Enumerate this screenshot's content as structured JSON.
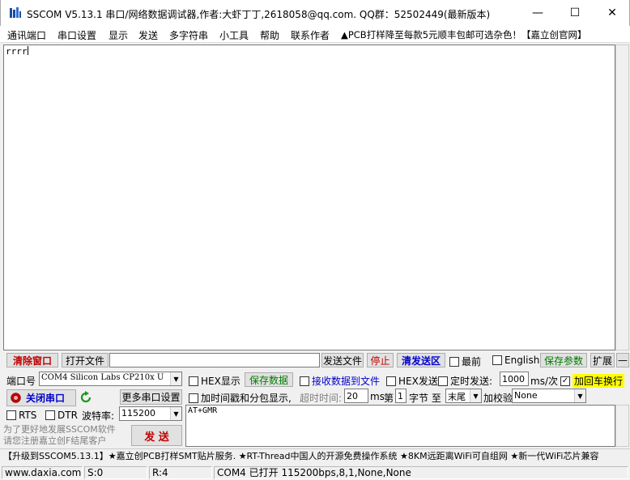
{
  "window": {
    "title": "SSCOM V5.13.1 串口/网络数据调试器,作者:大虾丁丁,2618058@qq.com. QQ群：52502449(最新版本)",
    "minimize": "—",
    "maximize": "☐",
    "close": "✕"
  },
  "menu": [
    "通讯端口",
    "串口设置",
    "显示",
    "发送",
    "多字符串",
    "小工具",
    "帮助",
    "联系作者",
    "▲PCB打样降至每款5元顺丰包邮可选杂色！【嘉立创官网】"
  ],
  "receive": {
    "text": "rrrr"
  },
  "toolbar": {
    "clear_window": "清除窗口",
    "open_file": "打开文件",
    "file_path": "",
    "send_file": "发送文件",
    "stop": "停止",
    "clear_send": "清发送区",
    "topmost": "最前",
    "english": "English",
    "save_params": "保存参数",
    "expand": "扩展",
    "collapse": "—"
  },
  "port": {
    "label": "端口号",
    "selected": "COM4 Silicon Labs CP210x U",
    "close_port": "关闭串口",
    "more_settings": "更多串口设置",
    "rts": "RTS",
    "dtr": "DTR",
    "baud_label": "波特率:",
    "baud": "115200",
    "promo_note": "为了更好地发展SSCOM软件\n请您注册嘉立创F结尾客户",
    "send_button": "发  送"
  },
  "options": {
    "hex_display": "HEX显示",
    "save_data": "保存数据",
    "recv_to_file": "接收数据到文件",
    "hex_send": "HEX发送",
    "timed_send": "定时发送:",
    "timed_interval": "1000",
    "timed_unit": "ms/次",
    "add_crlf": "加回车换行",
    "timestamp": "加时间戳和分包显示,",
    "timeout_label": "超时时间:",
    "timeout_value": "20",
    "timeout_unit": "ms",
    "byte_prefix": "第",
    "byte_index": "1",
    "byte_mid": "字节 至",
    "byte_end": "末尾",
    "checksum_label": "加校验",
    "checksum": "None"
  },
  "send": {
    "text": "AT+GMR"
  },
  "ticker": "【升级到SSCOM5.13.1】★嘉立创PCB打样SMT贴片服务. ★RT-Thread中国人的开源免费操作系统 ★8KM远距离WiFi可自组网 ★新一代WiFi芯片兼容",
  "status": {
    "website": "www.daxia.com",
    "sent": "S:0",
    "received": "R:4",
    "port_state": "COM4 已打开  115200bps,8,1,None,None"
  },
  "colors": {
    "red_label": "#c00000",
    "green_label": "#007a00",
    "blue_label": "#0000cc",
    "crlf_highlight": "#ffff00"
  }
}
